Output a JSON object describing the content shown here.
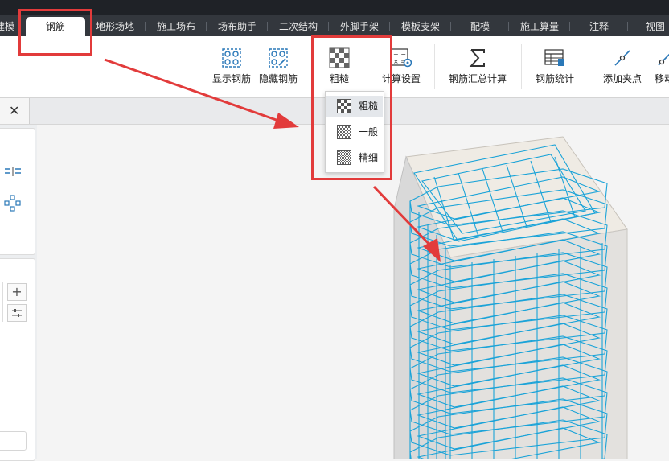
{
  "tabs": [
    {
      "label": "建模"
    },
    {
      "label": "钢筋"
    },
    {
      "label": "地形场地"
    },
    {
      "label": "施工场布"
    },
    {
      "label": "场布助手"
    },
    {
      "label": "二次结构"
    },
    {
      "label": "外脚手架"
    },
    {
      "label": "模板支架"
    },
    {
      "label": "配模"
    },
    {
      "label": "施工算量"
    },
    {
      "label": "注释"
    },
    {
      "label": "视图"
    }
  ],
  "active_tab": "钢筋",
  "ribbon": {
    "show_rebar": "显示钢筋",
    "hide_rebar": "隐藏钢筋",
    "coarse": "粗糙",
    "calc_settings": "计算设置",
    "rebar_summary": "钢筋汇总计算",
    "rebar_stats": "钢筋统计",
    "add_clamp": "添加夹点",
    "move": "移动"
  },
  "detail_dropdown": {
    "options": [
      "粗糙",
      "一般",
      "精细"
    ],
    "selected": "粗糙"
  },
  "docbar": {
    "close_symbol": "✕"
  },
  "left_panel": {
    "plus_symbol": "+"
  },
  "colors": {
    "tabbar": "#33373d",
    "highlight": "#e23b3b",
    "rebar": "#1aa3d8",
    "icon_blue": "#2a78b8"
  }
}
